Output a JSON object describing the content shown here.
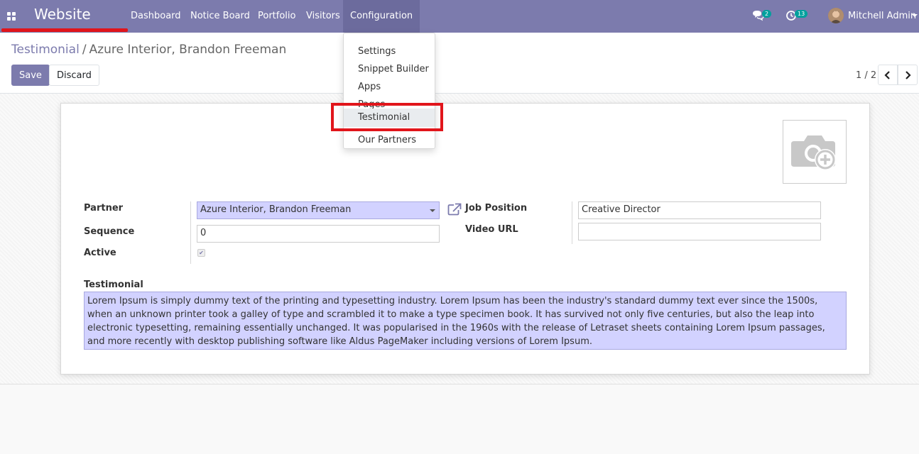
{
  "app": {
    "title": "Website"
  },
  "navbar": {
    "menus": [
      "Dashboard",
      "Notice Board",
      "Portfolio",
      "Visitors",
      "Configuration"
    ],
    "messages_badge": "2",
    "activities_badge": "13",
    "user_name": "Mitchell Admin"
  },
  "breadcrumb": {
    "parent": "Testimonial",
    "separator": "/",
    "current": "Azure Interior, Brandon Freeman"
  },
  "buttons": {
    "save": "Save",
    "discard": "Discard"
  },
  "pager": {
    "value": "1 / 2"
  },
  "form": {
    "partner_label": "Partner",
    "partner_value": "Azure Interior, Brandon Freeman",
    "sequence_label": "Sequence",
    "sequence_value": "0",
    "active_label": "Active",
    "active_checked": true,
    "job_position_label": "Job Position",
    "job_position_value": "Creative Director",
    "video_url_label": "Video URL",
    "video_url_value": "",
    "testimonial_label": "Testimonial",
    "testimonial_value": "Lorem Ipsum is simply dummy text of the printing and typesetting industry. Lorem Ipsum has been the industry's standard dummy text ever since the 1500s, when an unknown printer took a galley of type and scrambled it to make a type specimen book. It has survived not only five centuries, but also the leap into electronic typesetting, remaining essentially unchanged. It was popularised in the 1960s with the release of Letraset sheets containing Lorem Ipsum passages, and more recently with desktop publishing software like Aldus PageMaker including versions of Lorem Ipsum."
  },
  "dropdown": {
    "items": [
      "Settings",
      "Snippet Builder",
      "Apps",
      "Pages",
      "Testimonial",
      "Our Partners"
    ],
    "active_item": "Testimonial"
  },
  "colors": {
    "brand": "#7c7bad",
    "highlight": "#e1151b",
    "required_field": "#d2d2ff"
  }
}
